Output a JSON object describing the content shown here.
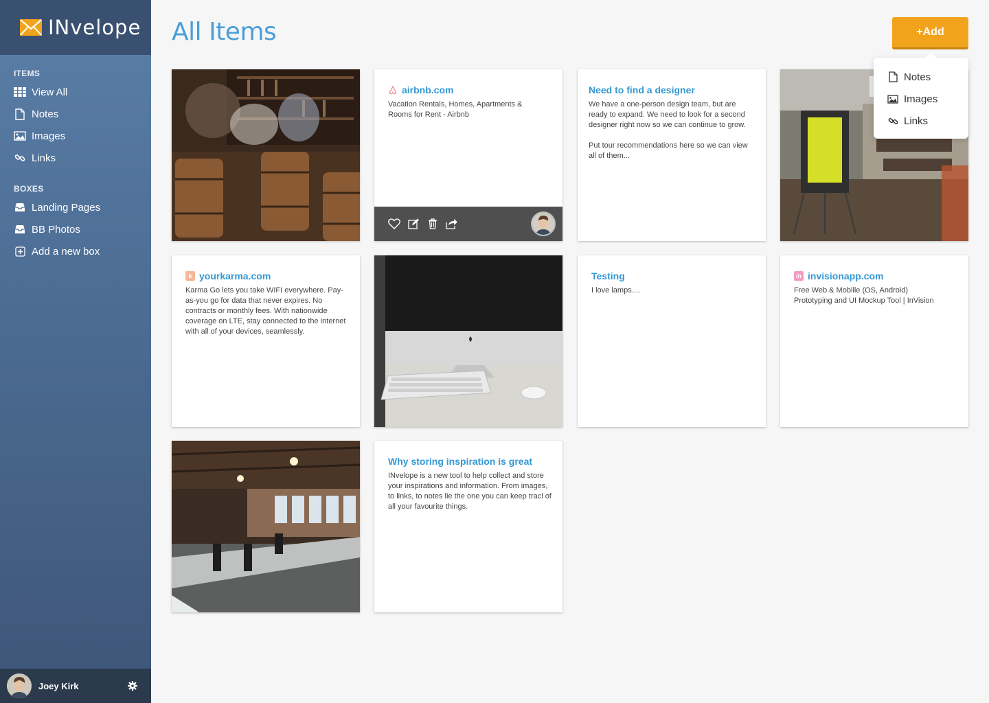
{
  "brand": {
    "name": "INvelope"
  },
  "sidebar": {
    "items_heading": "ITEMS",
    "items": [
      {
        "label": "View All",
        "icon": "grid-icon"
      },
      {
        "label": "Notes",
        "icon": "note-icon"
      },
      {
        "label": "Images",
        "icon": "image-icon"
      },
      {
        "label": "Links",
        "icon": "link-icon"
      }
    ],
    "boxes_heading": "BOXES",
    "boxes": [
      {
        "label": "Landing Pages",
        "icon": "inbox-icon"
      },
      {
        "label": "BB Photos",
        "icon": "inbox-icon"
      },
      {
        "label": "Add a new box",
        "icon": "plus-square-icon"
      }
    ]
  },
  "user": {
    "name": "Joey Kirk"
  },
  "page": {
    "title": "All Items"
  },
  "add_button": {
    "label": "+Add"
  },
  "dropdown": {
    "items": [
      {
        "label": "Notes",
        "icon": "note-icon"
      },
      {
        "label": "Images",
        "icon": "image-icon"
      },
      {
        "label": "Links",
        "icon": "link-icon"
      }
    ]
  },
  "cards": {
    "airbnb": {
      "title": "airbnb.com",
      "text": "Vacation Rentals, Homes, Apartments &\nRooms for Rent - Airbnb"
    },
    "designer": {
      "title": "Need to find a designer",
      "text": "We have a one-person design team, but are ready to expand. We need to look for a second designer right now so we can continue to grow.\n\nPut tour recommendations here so we can view all of them..."
    },
    "karma": {
      "title": "yourkarma.com",
      "text": "Karma Go lets you take WIFI everywhere. Pay-as-you go for data that never expires. No contracts or monthly fees. With nationwide coverage on LTE, stay connected to the internet with all of your devices, seamlessly."
    },
    "testing": {
      "title": "Testing",
      "text": "I love lamps...."
    },
    "invision": {
      "title": "invisionapp.com",
      "text": "Free Web & Moblile (OS, Android)\nPrototyping and UI Mockup Tool | InVision"
    },
    "inspiration": {
      "title": "Why storing inspiration is great",
      "text": "INvelope is a new tool to help collect and store your inspirations and information. From images, to links, to notes lie the one you can keep tracl of all your favourite things."
    }
  },
  "colors": {
    "accent": "#4a9ed8",
    "add_button": "#f2a31c",
    "sidebar_top": "#5b7fa8",
    "sidebar_bottom": "#3e5577",
    "link_title": "#3398d3"
  }
}
